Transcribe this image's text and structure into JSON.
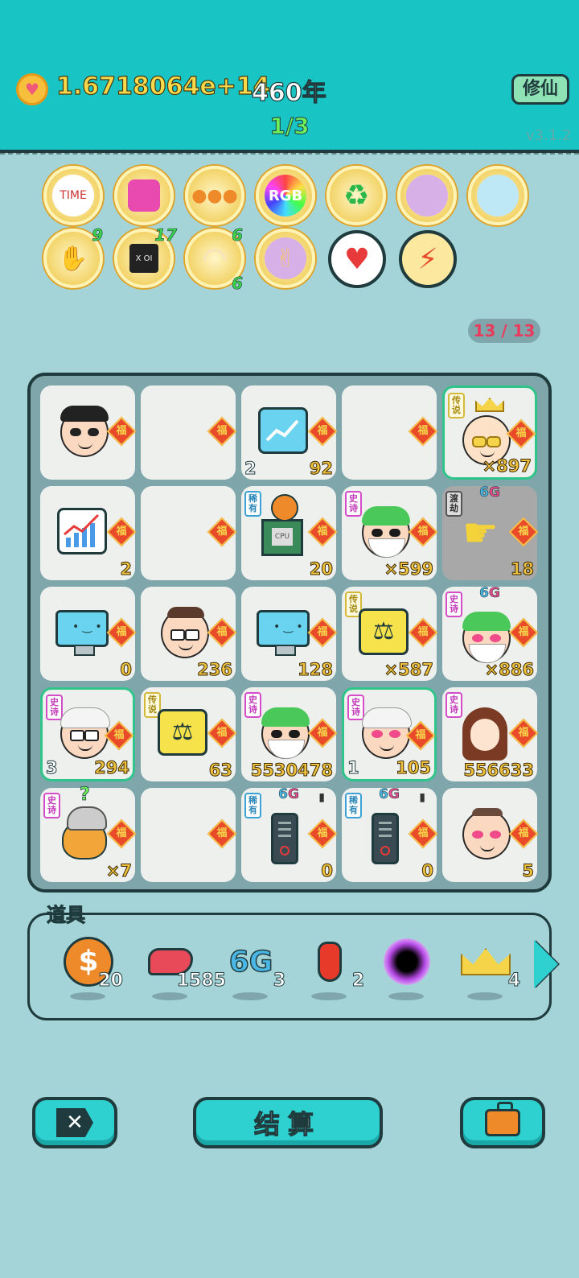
{
  "header": {
    "coins": "1.6718064e+14",
    "years": "460年",
    "page": "1/3",
    "xiuxian_label": "修仙",
    "version": "v3.1.2"
  },
  "buffs": [
    {
      "name": "time-magazine-icon",
      "count": ""
    },
    {
      "name": "gift-box-icon",
      "count": ""
    },
    {
      "name": "basketballs-icon",
      "count": ""
    },
    {
      "name": "rgb-icon",
      "count": ""
    },
    {
      "name": "recycle-icon",
      "count": ""
    },
    {
      "name": "code-head-icon",
      "count": ""
    },
    {
      "name": "air-pump-icon",
      "count": ""
    },
    {
      "name": "handshake-icon",
      "count": "9"
    },
    {
      "name": "cpu-chip-icon",
      "count": "17"
    },
    {
      "name": "shell-icon",
      "count": "6",
      "count2": "6"
    },
    {
      "name": "rock-hand-icon",
      "count": ""
    },
    {
      "name": "heart-potion-icon",
      "count": ""
    },
    {
      "name": "lightning-icon",
      "count": ""
    }
  ],
  "progress": "13 / 13",
  "grid": {
    "fu": "福",
    "tags": {
      "epic": "史诗",
      "rare": "稀有",
      "legend": "传说",
      "dujie": "渡劫"
    },
    "sixg": "6",
    "sixg_g": "G",
    "cells": [
      {
        "value": ""
      },
      {
        "value": ""
      },
      {
        "level": "2",
        "value": "92"
      },
      {
        "value": ""
      },
      {
        "value": "×897"
      },
      {
        "value": "2"
      },
      {
        "value": ""
      },
      {
        "value": "20"
      },
      {
        "value": "×599"
      },
      {
        "value": "18"
      },
      {
        "value": "0"
      },
      {
        "value": "236"
      },
      {
        "value": "128"
      },
      {
        "value": "×587"
      },
      {
        "value": "×886"
      },
      {
        "level": "3",
        "value": "294"
      },
      {
        "value": "63"
      },
      {
        "value": "5530478"
      },
      {
        "level": "1",
        "value": "105"
      },
      {
        "value": "556633"
      },
      {
        "value": "×7"
      },
      {
        "value": ""
      },
      {
        "value": "0"
      },
      {
        "value": "0"
      },
      {
        "value": "5"
      }
    ]
  },
  "items_label": "道具",
  "items": [
    {
      "name": "dollar-coin-icon",
      "glyph": "$",
      "qty": "20"
    },
    {
      "name": "liver-icon",
      "glyph": "",
      "qty": "1585"
    },
    {
      "name": "6g-icon",
      "glyph": "6G",
      "qty": "3"
    },
    {
      "name": "chili-icon",
      "glyph": "",
      "qty": "2"
    },
    {
      "name": "black-hole-icon",
      "glyph": "",
      "qty": ""
    },
    {
      "name": "crown-icon",
      "glyph": "",
      "qty": "4"
    }
  ],
  "buttons": {
    "close_glyph": "✕",
    "settle_label": "结算"
  },
  "colors": {
    "accent": "#18c4c4",
    "background": "#a4d4d8",
    "value_gold": "#f1c33c",
    "tag_epic": "#c23aba",
    "tag_rare": "#2a86b8"
  }
}
